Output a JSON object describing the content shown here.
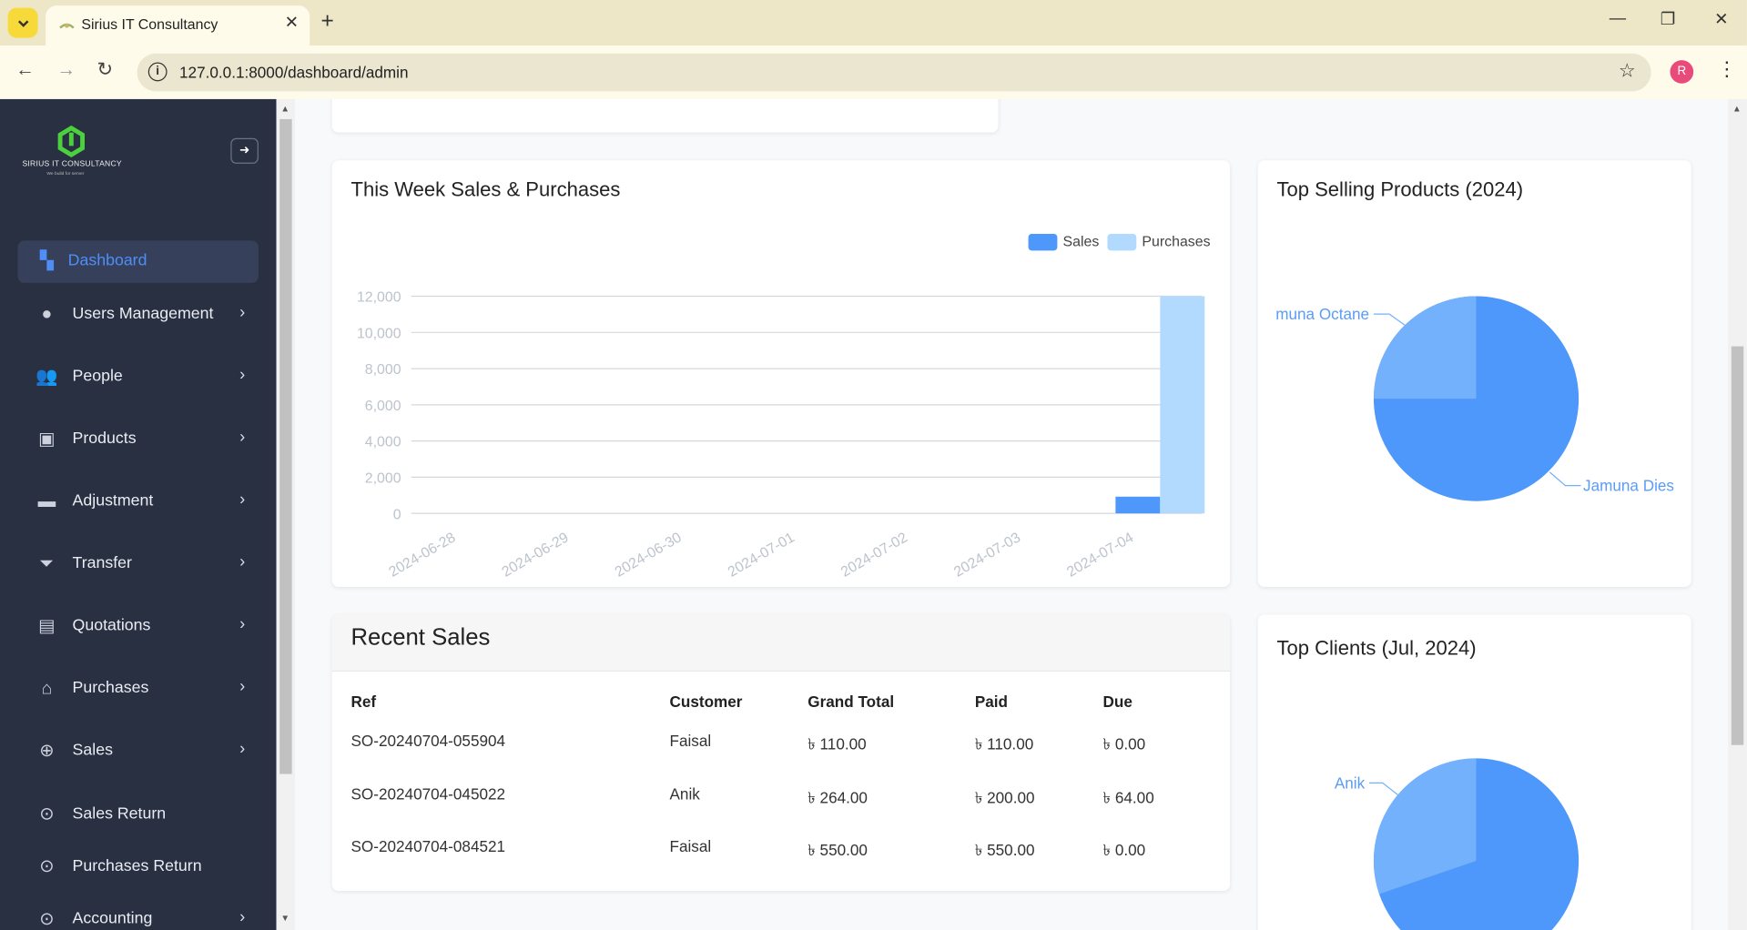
{
  "browser": {
    "tab_title": "Sirius IT Consultancy",
    "url": "127.0.0.1:8000/dashboard/admin",
    "profile_initial": "R"
  },
  "sidebar": {
    "logo_text": "SIRIUS IT CONSULTANCY",
    "logo_tagline": "We build for server",
    "items": [
      {
        "label": "Dashboard",
        "icon": "dashboard-icon",
        "active": true,
        "has_submenu": false
      },
      {
        "label": "Users Management",
        "icon": "user-icon",
        "active": false,
        "has_submenu": true
      },
      {
        "label": "People",
        "icon": "people-icon",
        "active": false,
        "has_submenu": true
      },
      {
        "label": "Products",
        "icon": "products-icon",
        "active": false,
        "has_submenu": true
      },
      {
        "label": "Adjustment",
        "icon": "adjustment-icon",
        "active": false,
        "has_submenu": true
      },
      {
        "label": "Transfer",
        "icon": "transfer-icon",
        "active": false,
        "has_submenu": true
      },
      {
        "label": "Quotations",
        "icon": "clipboard-icon",
        "active": false,
        "has_submenu": true
      },
      {
        "label": "Purchases",
        "icon": "bag-icon",
        "active": false,
        "has_submenu": true
      },
      {
        "label": "Sales",
        "icon": "cart-icon",
        "active": false,
        "has_submenu": true
      },
      {
        "label": "Sales Return",
        "icon": "sales-return-icon",
        "active": false,
        "has_submenu": false
      },
      {
        "label": "Purchases Return",
        "icon": "purchases-return-icon",
        "active": false,
        "has_submenu": false
      },
      {
        "label": "Accounting",
        "icon": "accounting-icon",
        "active": false,
        "has_submenu": true
      }
    ]
  },
  "week_chart": {
    "title": "This Week Sales & Purchases",
    "chart_data": {
      "type": "bar",
      "categories": [
        "2024-06-28",
        "2024-06-29",
        "2024-06-30",
        "2024-07-01",
        "2024-07-02",
        "2024-07-03",
        "2024-07-04"
      ],
      "series": [
        {
          "name": "Sales",
          "values": [
            0,
            0,
            0,
            0,
            0,
            0,
            924
          ],
          "color": "#4e97fb"
        },
        {
          "name": "Purchases",
          "values": [
            0,
            0,
            0,
            0,
            0,
            0,
            12000
          ],
          "color": "#b2dafe"
        }
      ],
      "ylim": [
        0,
        12000
      ],
      "yticks": [
        "0",
        "2,000",
        "4,000",
        "6,000",
        "8,000",
        "10,000",
        "12,000"
      ],
      "legend": "top-right",
      "grid": true
    }
  },
  "top_products": {
    "title": "Top Selling Products (2024)",
    "chart_data": {
      "type": "pie",
      "labels": [
        "Jamuna  Dies",
        "muna Octane"
      ],
      "values": [
        75,
        25
      ],
      "colors": [
        "#4e97fb",
        "#74b1fc"
      ]
    }
  },
  "recent_sales": {
    "title": "Recent Sales",
    "columns": [
      "Ref",
      "Customer",
      "Grand Total",
      "Paid",
      "Due"
    ],
    "rows": [
      [
        "SO-20240704-055904",
        "Faisal",
        "৳ 110.00",
        "৳ 110.00",
        "৳ 0.00"
      ],
      [
        "SO-20240704-045022",
        "Anik",
        "৳ 264.00",
        "৳ 200.00",
        "৳ 64.00"
      ],
      [
        "SO-20240704-084521",
        "Faisal",
        "৳ 550.00",
        "৳ 550.00",
        "৳ 0.00"
      ]
    ]
  },
  "top_clients": {
    "title": "Top Clients (Jul, 2024)",
    "chart_data": {
      "type": "pie",
      "labels": [
        "Anik"
      ],
      "values": [
        30,
        70
      ],
      "colors": [
        "#74b1fc",
        "#4e97fb"
      ]
    }
  }
}
